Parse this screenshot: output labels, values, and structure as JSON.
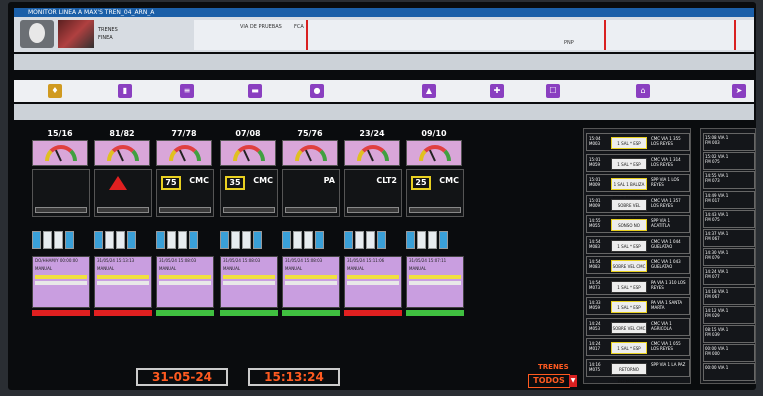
{
  "window": {
    "title": "MONITOR LINEA A MAX'S TREN_04_ARN_A"
  },
  "train": {
    "label": "TRENES",
    "sub": "FINEA"
  },
  "track": {
    "name": "VIA DE PRUEBAS",
    "marker_left": "FCA",
    "marker_right": "PNP"
  },
  "units": [
    {
      "id": "15/16",
      "num": "",
      "label": "",
      "date": "DO/HHAM/Y",
      "time": "00:00:00"
    },
    {
      "id": "81/82",
      "num": "",
      "label": "",
      "date": "31/05/24",
      "time": "15:13:13"
    },
    {
      "id": "77/78",
      "num": "75",
      "label": "CMC",
      "date": "31/05/24",
      "time": "15:08:03"
    },
    {
      "id": "07/08",
      "num": "35",
      "label": "CMC",
      "date": "31/05/24",
      "time": "15:08:03"
    },
    {
      "id": "75/76",
      "num": "",
      "label": "PA",
      "date": "31/05/24",
      "time": "15:08:03"
    },
    {
      "id": "23/24",
      "num": "",
      "label": "CLT2",
      "date": "31/05/24",
      "time": "15:11:06"
    },
    {
      "id": "09/10",
      "num": "25",
      "label": "CMC",
      "date": "31/05/24",
      "time": "15:07:11"
    }
  ],
  "mode_label": "MANUAL",
  "footer": {
    "date": "31-05-24",
    "time": "15:13:24"
  },
  "filter": {
    "label": "TRENES",
    "value": "TODOS"
  },
  "right_list": [
    {
      "id": "15:04 M003",
      "box": "1 SAL * ESP",
      "side": "CMC VIA 1 355 LOS REYES"
    },
    {
      "id": "15:01 M059",
      "box": "1 SAL * ESP",
      "side": "CMC VIA 1 314 LOS REYES"
    },
    {
      "id": "15:01 M009",
      "box": "1 SAL 1 BALIZA BALIZ BLOQUEA",
      "side": "SPP VIA 1 LOS REYES"
    },
    {
      "id": "15:01 M009",
      "box": "SOBRE VEL REDUCCION PUNTO META",
      "side": "CMC VIA 1 357 LOS REYES"
    },
    {
      "id": "14:55 M055",
      "box": "SONSO NO REDUCCION PUNTO META",
      "side": "SPP VIA 1 ACATITLA"
    },
    {
      "id": "14:54 M083",
      "box": "1 SAL * ESP",
      "side": "CMC VIA 1 044 GUELATAO"
    },
    {
      "id": "14:54 M083",
      "box": "SOBRE VEL CMC",
      "side": "CMC VIA 1 043 GUELATAO"
    },
    {
      "id": "14:54 M073",
      "box": "1 SAL * ESP",
      "side": "PA VIA 1 310 LOS REYES"
    },
    {
      "id": "14:33 M059",
      "box": "1 SAL * ESP",
      "side": "PA VIA 1 SANTA MARTA"
    },
    {
      "id": "14:24 M053",
      "box": "SOBRE VEL CMC",
      "side": "CMC VIA 1 AGRICOLA"
    },
    {
      "id": "14:24 M017",
      "box": "1 SAL * ESP",
      "side": "CMC VIA 1 055 LOS REYES"
    },
    {
      "id": "14:16 M075",
      "box": "RETORNO PERMISIVO",
      "side": "SPP VIA 1 LA PAZ"
    }
  ],
  "far_list": [
    {
      "time": "15:08",
      "route": "FM 003",
      "via": "VIA 1"
    },
    {
      "time": "15:02",
      "route": "FM 075",
      "via": "VIA 1"
    },
    {
      "time": "14:55",
      "route": "FM 073",
      "via": "VIA 1"
    },
    {
      "time": "14:49",
      "route": "FM 017",
      "via": "VIA 1"
    },
    {
      "time": "14:43",
      "route": "FM 075",
      "via": "VIA 1"
    },
    {
      "time": "14:37",
      "route": "FM 067",
      "via": "VIA 1"
    },
    {
      "time": "14:30",
      "route": "FM 079",
      "via": "VIA 1"
    },
    {
      "time": "14:24",
      "route": "FM 077",
      "via": "VIA 1"
    },
    {
      "time": "14:18",
      "route": "FM 067",
      "via": "VIA 1"
    },
    {
      "time": "14:12",
      "route": "FM 029",
      "via": "VIA 1"
    },
    {
      "time": "08:15",
      "route": "FM 039",
      "via": "VIA 1"
    },
    {
      "time": "00:00",
      "route": "FM 000",
      "via": "VIA 1"
    },
    {
      "time": "00:00",
      "route": "",
      "via": "VIA 1"
    }
  ]
}
